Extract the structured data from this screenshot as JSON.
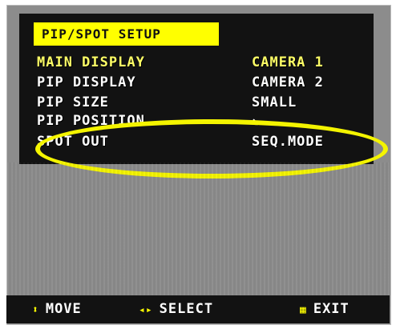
{
  "menu": {
    "title": "PIP/SPOT SETUP",
    "rows": [
      {
        "label": "MAIN DISPLAY",
        "value": "CAMERA 1"
      },
      {
        "label": "PIP DISPLAY",
        "value": "CAMERA 2"
      },
      {
        "label": "PIP SIZE",
        "value": "SMALL"
      },
      {
        "label": "PIP POSITION",
        "value": "↘"
      },
      {
        "label": "SPOT OUT",
        "value": "SEQ.MODE"
      }
    ]
  },
  "footer": {
    "move_icon": "⬍",
    "move": "MOVE",
    "select_icon": "◂▸",
    "select": "SELECT",
    "exit_icon": "▦",
    "exit": "EXIT"
  },
  "colors": {
    "title_bg": "#ffff00",
    "active_text": "#ffff66",
    "annotation": "#f4f400"
  }
}
